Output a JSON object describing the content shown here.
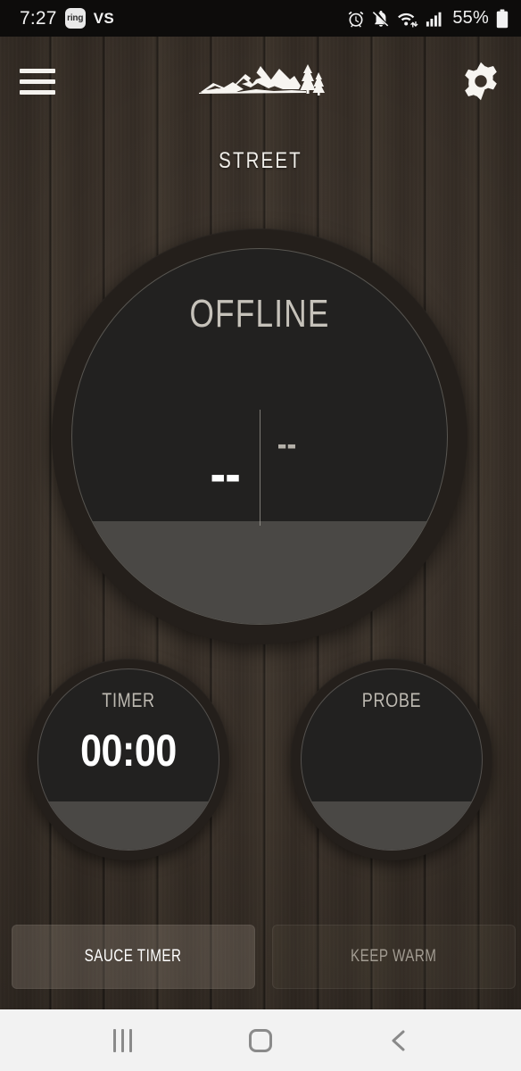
{
  "statusbar": {
    "time": "7:27",
    "app_badge": "ring",
    "carrier": "VS",
    "battery_percent": "55%",
    "icons": [
      "alarm-icon",
      "mute-icon",
      "wifi-icon",
      "signal-icon",
      "battery-icon"
    ]
  },
  "topbar": {
    "menu_label": "menu",
    "logo_label": "mountain-pines-logo",
    "settings_label": "settings"
  },
  "header": {
    "grill_name": "STREET"
  },
  "main_dial": {
    "status": "OFFLINE",
    "current_temp": "--",
    "target_temp": "--"
  },
  "sub_dials": [
    {
      "label": "TIMER",
      "value": "00:00"
    },
    {
      "label": "PROBE",
      "value": ""
    }
  ],
  "actions": [
    {
      "label": "SAUCE TIMER",
      "state": "enabled"
    },
    {
      "label": "KEEP WARM",
      "state": "disabled"
    }
  ],
  "navbar": {
    "recents_label": "recents",
    "home_label": "home",
    "back_label": "back"
  },
  "colors": {
    "wood_dark": "#2f2822",
    "wood_light": "#3e352c",
    "dial_ring": "#241f1b",
    "dial_face": "#222120",
    "dial_fill": "#4a4845",
    "text_primary": "#ffffff",
    "text_muted": "#bdb9b1",
    "navbar_bg": "#f2f2f2",
    "navbar_icon": "#8a8a8a"
  }
}
